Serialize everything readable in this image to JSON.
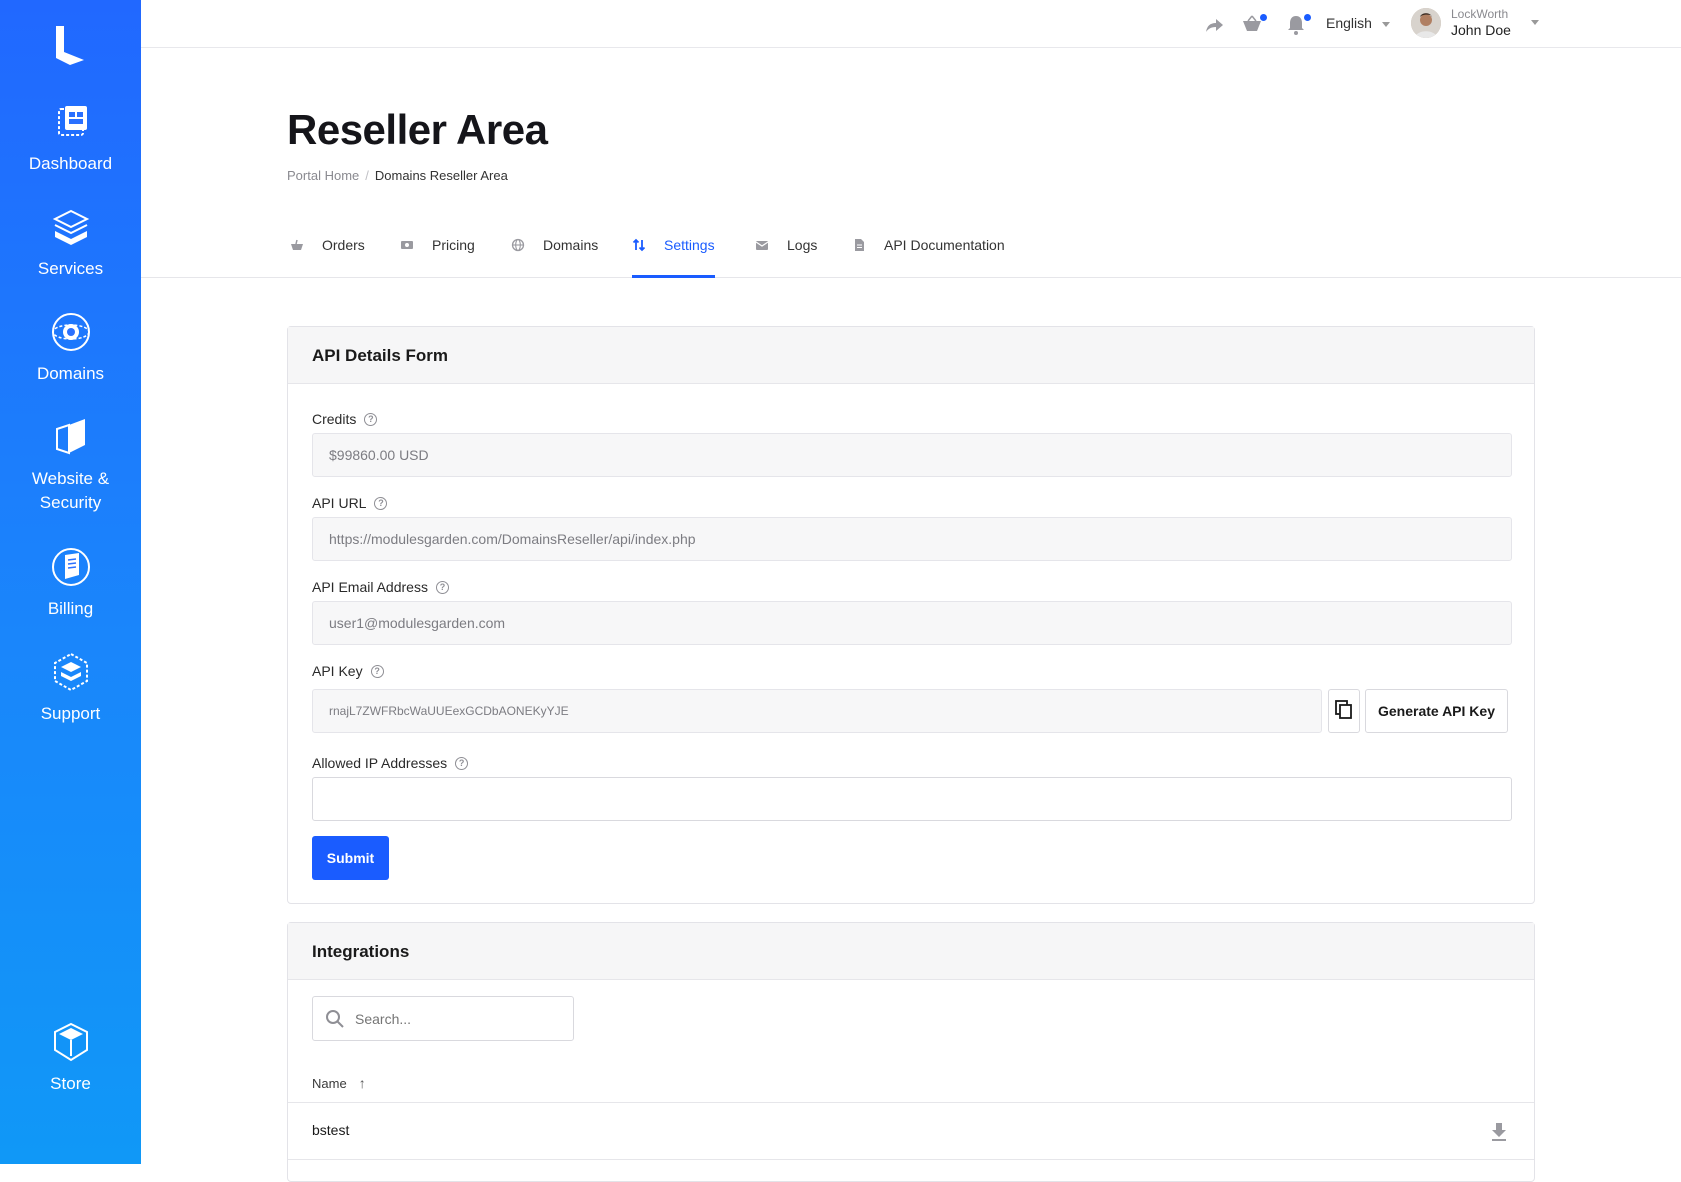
{
  "sidebar": {
    "items": [
      {
        "label": "Dashboard",
        "icon": "dashboard-icon"
      },
      {
        "label": "Services",
        "icon": "services-icon"
      },
      {
        "label": "Domains",
        "icon": "domains-icon"
      },
      {
        "label": "Website & Security",
        "icon": "website-security-icon"
      },
      {
        "label": "Billing",
        "icon": "billing-icon"
      },
      {
        "label": "Support",
        "icon": "support-icon"
      }
    ],
    "store": {
      "label": "Store",
      "icon": "store-icon"
    }
  },
  "topbar": {
    "language": "English",
    "user_company": "LockWorth",
    "user_name": "John Doe",
    "accent": "#1a5cff"
  },
  "page": {
    "title": "Reseller Area",
    "breadcrumb": [
      "Portal Home",
      "Domains Reseller Area"
    ]
  },
  "tabs": [
    {
      "label": "Orders",
      "icon": "orders-icon",
      "active": false
    },
    {
      "label": "Pricing",
      "icon": "pricing-icon",
      "active": false
    },
    {
      "label": "Domains",
      "icon": "globe-icon",
      "active": false
    },
    {
      "label": "Settings",
      "icon": "settings-icon",
      "active": true
    },
    {
      "label": "Logs",
      "icon": "logs-icon",
      "active": false
    },
    {
      "label": "API Documentation",
      "icon": "document-icon",
      "active": false
    }
  ],
  "api_form": {
    "title": "API Details Form",
    "credits_label": "Credits",
    "credits_value": "$99860.00 USD",
    "api_url_label": "API URL",
    "api_url_value": "https://modulesgarden.com/DomainsReseller/api/index.php",
    "api_email_label": "API Email Address",
    "api_email_value": "user1@modulesgarden.com",
    "api_key_label": "API Key",
    "api_key_value": "rnajL7ZWFRbcWaUUEexGCDbAONEKyYJE",
    "generate_label": "Generate API Key",
    "allowed_ip_label": "Allowed IP Addresses",
    "allowed_ip_value": "",
    "submit_label": "Submit"
  },
  "integrations": {
    "title": "Integrations",
    "search_placeholder": "Search...",
    "column_name": "Name",
    "rows": [
      {
        "name": "bstest"
      }
    ]
  }
}
